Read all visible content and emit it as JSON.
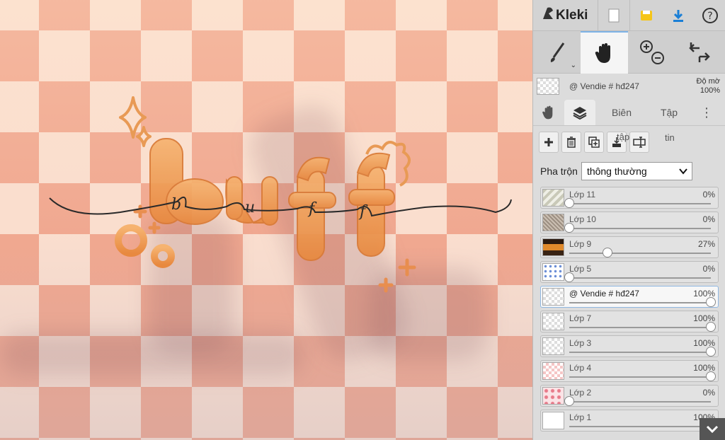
{
  "app": {
    "name": "Kleki"
  },
  "topbar": {
    "new_icon": "new-file-icon",
    "save_icon": "save-icon",
    "download_icon": "download-icon",
    "help_icon": "help-icon"
  },
  "toolbar": {
    "tools": [
      "brush-icon",
      "hand-icon",
      "zoom-icon",
      "undo-redo-icon"
    ]
  },
  "current_layer": {
    "name": "@ Vendie # hđ247",
    "opacity_label": "Độ mờ",
    "opacity": "100%"
  },
  "tabs": [
    "Biên",
    "Tập"
  ],
  "layer_actions": {
    "merge_label": "tập",
    "info_label": "tin"
  },
  "blend": {
    "label": "Pha trộn",
    "value": "thông thường"
  },
  "layers": [
    {
      "name": "Lớp 11",
      "opacity": "0%",
      "level": 0,
      "selected": false,
      "thumb": "stripes"
    },
    {
      "name": "Lớp 10",
      "opacity": "0%",
      "level": 0,
      "selected": false,
      "thumb": "texture"
    },
    {
      "name": "Lớp 9",
      "opacity": "27%",
      "level": 0.27,
      "selected": false,
      "thumb": "photo"
    },
    {
      "name": "Lớp 5",
      "opacity": "0%",
      "level": 0,
      "selected": false,
      "thumb": "dots"
    },
    {
      "name": "@ Vendie # hđ247",
      "opacity": "100%",
      "level": 1,
      "selected": true,
      "thumb": "checker"
    },
    {
      "name": "Lớp 7",
      "opacity": "100%",
      "level": 1,
      "selected": false,
      "thumb": "checker"
    },
    {
      "name": "Lớp 3",
      "opacity": "100%",
      "level": 1,
      "selected": false,
      "thumb": "checker"
    },
    {
      "name": "Lớp 4",
      "opacity": "100%",
      "level": 1,
      "selected": false,
      "thumb": "pink"
    },
    {
      "name": "Lớp 2",
      "opacity": "0%",
      "level": 0,
      "selected": false,
      "thumb": "pinkdots"
    },
    {
      "name": "Lớp 1",
      "opacity": "100%",
      "level": 1,
      "selected": false,
      "thumb": "white"
    }
  ],
  "canvas": {
    "lettering": "buff",
    "script_letters": [
      "b",
      "u",
      "f",
      "f"
    ]
  },
  "colors": {
    "accent": "#1a7fd6",
    "panel": "#dcdcdc",
    "orange": "#f0a060"
  }
}
